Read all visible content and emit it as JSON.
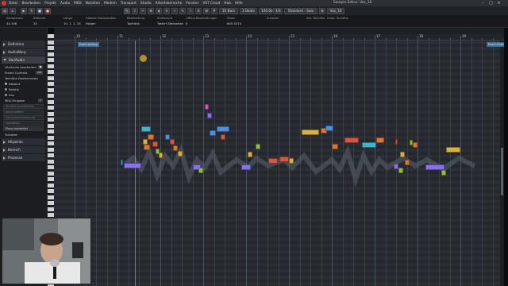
{
  "window": {
    "title": "Sample-Editor: Vox_16",
    "menu": [
      "Datei",
      "Bearbeiten",
      "Projekt",
      "Audio",
      "MIDI",
      "Notation",
      "Medien",
      "Transport",
      "Studio",
      "Arbeitsbereiche",
      "Fenster",
      "VST Cloud",
      "Hub",
      "Hilfe"
    ],
    "controls": {
      "minimize": "–",
      "maximize": "□",
      "close": "×"
    }
  },
  "toolbar": {
    "button_icons": [
      "sidebar-toggle-icon",
      "lock-icon",
      "play-icon",
      "loop-icon",
      "stop-icon",
      "record-icon"
    ],
    "tool_icons": [
      "pointer-tool-icon",
      "pitch-tool-icon",
      "scissors-tool-icon",
      "glue-tool-icon",
      "speaker-tool-icon",
      "mute-tool-icon",
      "zoom-tool-icon",
      "pen-tool-icon",
      "warp-tool-icon",
      "straighten-tool-icon",
      "snap-icon",
      "grid-icon"
    ],
    "bars_value": "10 Bars",
    "beats_value": "2 Beats",
    "tempo_value": "140.00",
    "signature_value": "4/4",
    "mode_value": "Standard - Solo",
    "track_value": "Vox_16"
  },
  "infoline": {
    "columns": [
      {
        "label": "Samplerate",
        "value": "44.100"
      },
      {
        "label": "Bitbreite",
        "value": "24"
      },
      {
        "label": "Länge",
        "value": "10. 1. 1. 24"
      },
      {
        "label": "Globale Transposition",
        "value": "Folgen"
      },
      {
        "label": "Bearbeitung",
        "value": "Tonhöhe"
      },
      {
        "label": "Zeitformat",
        "value": "Takte+Zählzeiten"
      },
      {
        "label": "Offline-Bearbeitungen",
        "value": "0"
      },
      {
        "label": "Zoom",
        "value": "645.5274"
      },
      {
        "label": "Auswahl",
        "value": ""
      },
      {
        "label": "Akt. Tonhöhe",
        "value": ""
      },
      {
        "label": "Urspr. Tonhöhe",
        "value": ""
      }
    ]
  },
  "inspector": {
    "sections": [
      {
        "label": "Definition",
        "open": false
      },
      {
        "label": "AudioWarp",
        "open": false
      },
      {
        "label": "VariAudio",
        "open": true
      },
      {
        "label": "Hitpoints",
        "open": false
      },
      {
        "label": "Bereich",
        "open": false
      },
      {
        "label": "Prozesse",
        "open": false
      }
    ],
    "variaudio": {
      "edit_label": "VariAudio bearbeiten",
      "smart_controls_label": "Smart Controls",
      "smart_controls_value": "Alle",
      "raster_label": "Tonhöhe-Rastermodus",
      "options": [
        "Absolut",
        "Relativ",
        "Aus"
      ],
      "selected_option": "Absolut",
      "midi_label": "MIDI-Eingabe",
      "disabled_fields": [
        "Tonhöhe quantisieren",
        "Kurve glätten",
        "Formantverschiebung",
        "Lautstärke"
      ],
      "pitch_label": "Piano bearbeitet",
      "pitch_value": "Tonhöhen"
    }
  },
  "ruler": {
    "bar_numbers": [
      "10",
      "11",
      "12",
      "13",
      "14",
      "15",
      "16",
      "17",
      "18",
      "19"
    ]
  },
  "markers": {
    "start": "Event-Anfang",
    "end": "Event-Ende"
  },
  "colors": {
    "note_blue": "#4a8fe0",
    "note_purple": "#8a6ff0",
    "note_yellow": "#d9b23a",
    "note_orange": "#e0762c",
    "note_red": "#d8553f",
    "note_green": "#8fc23a",
    "note_pink": "#d056c8",
    "note_teal": "#3fb6c8"
  }
}
